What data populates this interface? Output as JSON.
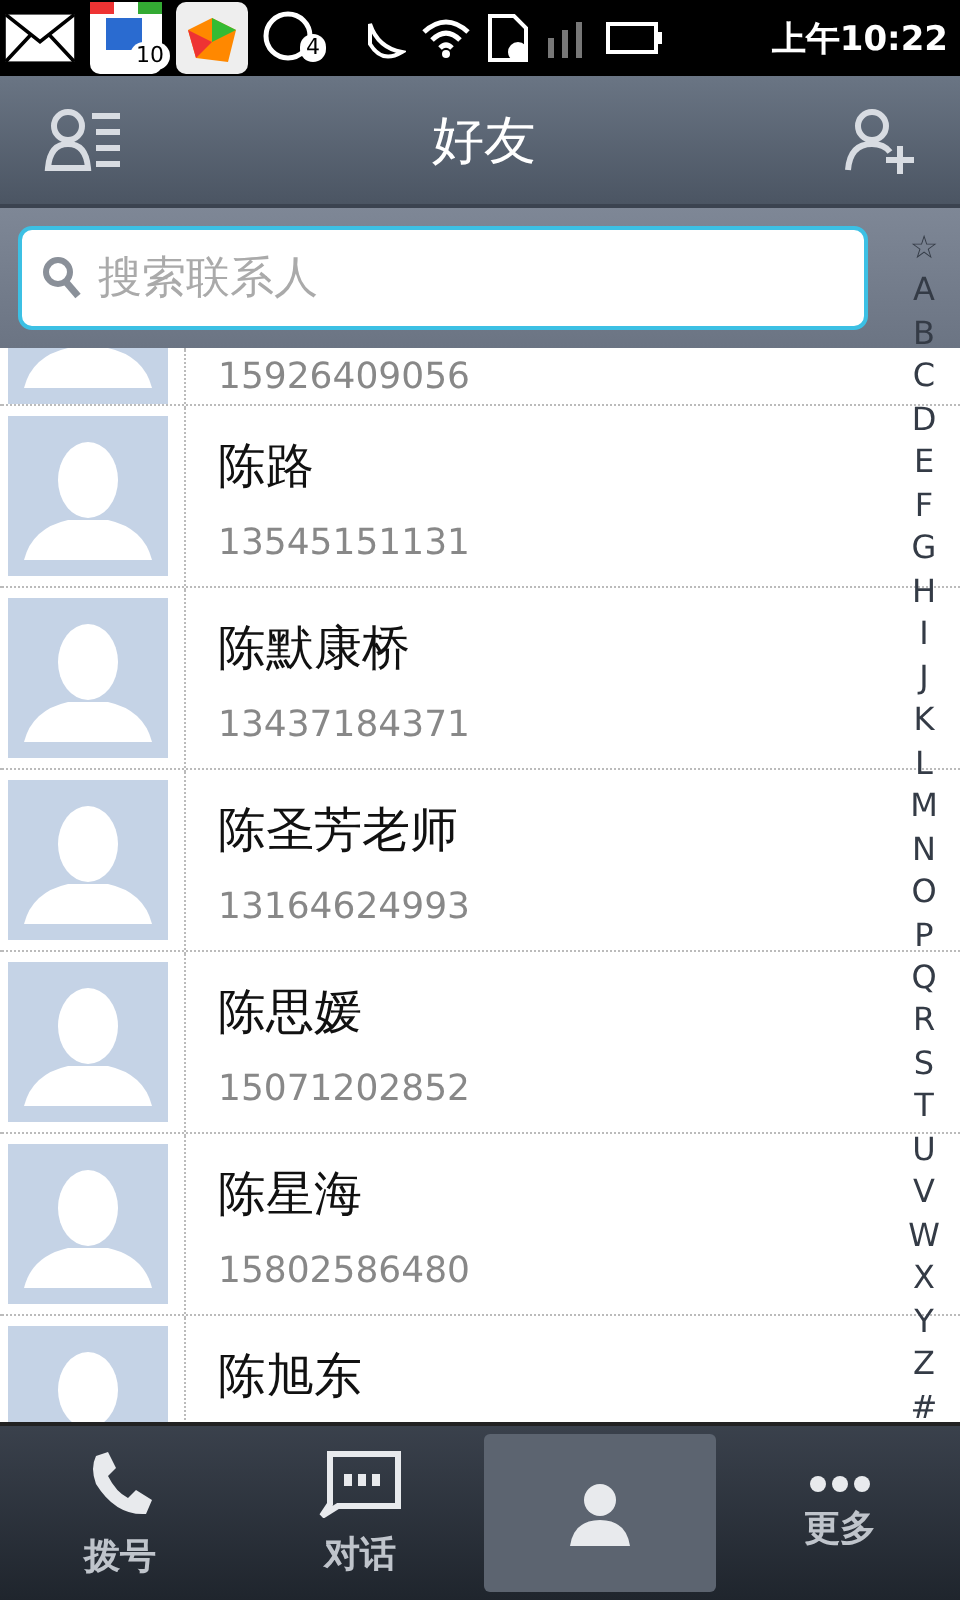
{
  "status_bar": {
    "badges": [
      "10",
      "4"
    ],
    "time": "上午10:22"
  },
  "header": {
    "title": "好友"
  },
  "search": {
    "placeholder": "搜索联系人"
  },
  "contacts": [
    {
      "phone": "15926409056",
      "partial": true
    },
    {
      "name": "陈路",
      "phone": "13545151131"
    },
    {
      "name": "陈默康桥",
      "phone": "13437184371"
    },
    {
      "name": "陈圣芳老师",
      "phone": "13164624993"
    },
    {
      "name": "陈思媛",
      "phone": "15071202852"
    },
    {
      "name": "陈星海",
      "phone": "15802586480"
    },
    {
      "name": "陈旭东"
    }
  ],
  "index": [
    "☆",
    "A",
    "B",
    "C",
    "D",
    "E",
    "F",
    "G",
    "H",
    "I",
    "J",
    "K",
    "L",
    "M",
    "N",
    "O",
    "P",
    "Q",
    "R",
    "S",
    "T",
    "U",
    "V",
    "W",
    "X",
    "Y",
    "Z",
    "#"
  ],
  "tabs": [
    {
      "label": "拨号",
      "kind": "phone",
      "selected": false
    },
    {
      "label": "对话",
      "kind": "chat",
      "selected": false
    },
    {
      "kind": "contacts",
      "selected": true
    },
    {
      "label": "更多",
      "kind": "more",
      "selected": false
    }
  ]
}
